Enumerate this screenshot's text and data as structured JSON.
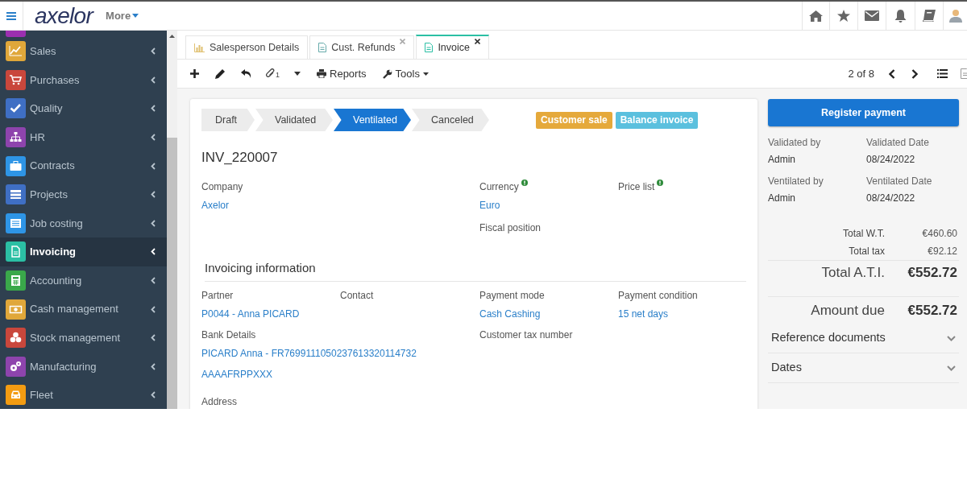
{
  "header": {
    "logo": "axelor",
    "more_menu": "More"
  },
  "sidebar": {
    "items": [
      {
        "label": "Sales",
        "color": "#e0a73a",
        "selected": false
      },
      {
        "label": "Purchases",
        "color": "#c9473c",
        "selected": false
      },
      {
        "label": "Quality",
        "color": "#3f6fc4",
        "selected": false
      },
      {
        "label": "HR",
        "color": "#8e44ad",
        "selected": false
      },
      {
        "label": "Contracts",
        "color": "#2e95e6",
        "selected": false
      },
      {
        "label": "Projects",
        "color": "#3f6fc4",
        "selected": false
      },
      {
        "label": "Job costing",
        "color": "#2e95e6",
        "selected": false
      },
      {
        "label": "Invoicing",
        "color": "#2bbfa4",
        "selected": true
      },
      {
        "label": "Accounting",
        "color": "#3aa84a",
        "selected": false
      },
      {
        "label": "Cash management",
        "color": "#e0a73a",
        "selected": false
      },
      {
        "label": "Stock management",
        "color": "#c9473c",
        "selected": false
      },
      {
        "label": "Manufacturing",
        "color": "#8e44ad",
        "selected": false
      },
      {
        "label": "Fleet",
        "color": "#f39c12",
        "selected": false
      }
    ]
  },
  "tabs": [
    {
      "label": "Salesperson Details",
      "selected": false,
      "closable": false
    },
    {
      "label": "Cust. Refunds",
      "selected": false,
      "closable": true
    },
    {
      "label": "Invoice",
      "selected": true,
      "closable": true
    }
  ],
  "toolbar": {
    "attachment_count": "1",
    "reports": "Reports",
    "tools": "Tools",
    "pager": "2 of 8"
  },
  "status_steps": [
    {
      "label": "Draft",
      "selected": false
    },
    {
      "label": "Validated",
      "selected": false
    },
    {
      "label": "Ventilated",
      "selected": true
    },
    {
      "label": "Canceled",
      "selected": false
    }
  ],
  "badges": [
    {
      "label": "Customer sale",
      "color": "#e5a93b"
    },
    {
      "label": "Balance invoice",
      "color": "#5bc0de"
    }
  ],
  "invoice_number": "INV_220007",
  "top_fields": [
    {
      "label": "Company",
      "value": "Axelor",
      "info": false
    },
    {
      "label": "Currency",
      "value": "Euro",
      "info": true
    },
    {
      "label": "Price list",
      "info": true
    },
    {
      "label": "Fiscal position",
      "info": false
    }
  ],
  "invoicing_information": {
    "title": "Invoicing information",
    "fields": [
      {
        "label": "Partner",
        "value": "P0044 - Anna PICARD"
      },
      {
        "label": "Contact"
      },
      {
        "label": "Payment mode",
        "value": "Cash Cashing"
      },
      {
        "label": "Payment condition",
        "value": "15 net days"
      }
    ],
    "bank_details": {
      "label": "Bank Details",
      "value": "PICARD Anna - FR7699111050237613320114732",
      "value_2": "AAAAFRPPXXX"
    },
    "customer_tax_number": {
      "label": "Customer tax number"
    },
    "address": {
      "label": "Address"
    }
  },
  "side_panel": {
    "button": "Register payment",
    "audit": [
      {
        "label": "Validated by",
        "value": "Admin"
      },
      {
        "label": "Validated Date",
        "value": "08/24/2022"
      },
      {
        "label": "Ventilated by",
        "value": "Admin"
      },
      {
        "label": "Ventilated Date",
        "value": "08/24/2022"
      }
    ],
    "totals": [
      {
        "label": "Total W.T.",
        "value": "€460.60",
        "kind": "small"
      },
      {
        "label": "Total tax",
        "value": "€92.12",
        "kind": "small"
      },
      {
        "label": "Total A.T.I.",
        "value": "€552.72",
        "kind": "large"
      },
      {
        "label": "Amount due",
        "value": "€552.72",
        "kind": "large"
      }
    ],
    "sections": [
      {
        "label": "Reference documents",
        "expanded": false
      },
      {
        "label": "Dates",
        "expanded": false
      }
    ]
  }
}
